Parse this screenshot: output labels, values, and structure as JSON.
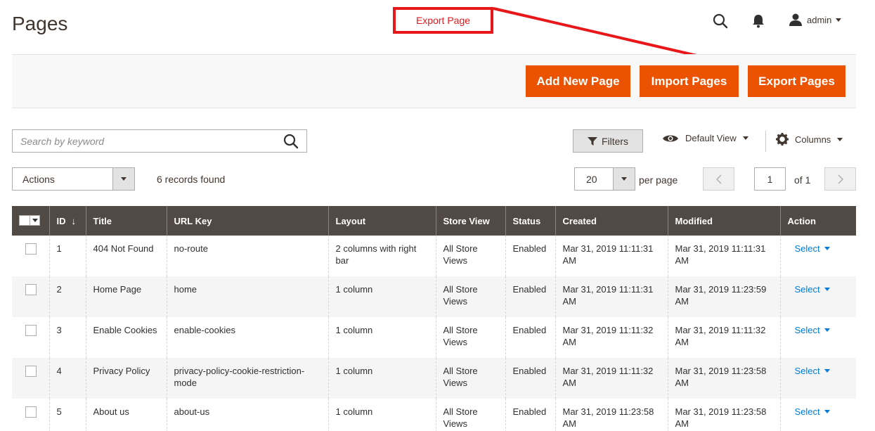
{
  "header": {
    "title": "Pages",
    "annotation_label": "Export Page",
    "user_name": "admin"
  },
  "toolbar": {
    "add_new_label": "Add New Page",
    "import_label": "Import Pages",
    "export_label": "Export Pages"
  },
  "search": {
    "placeholder": "Search by keyword"
  },
  "controls": {
    "filters_label": "Filters",
    "view_label": "Default View",
    "columns_label": "Columns",
    "actions_label": "Actions",
    "records_found": "6 records found",
    "per_page_value": "20",
    "per_page_label": "per page",
    "current_page": "1",
    "page_total": "of 1"
  },
  "grid": {
    "columns": [
      "ID",
      "Title",
      "URL Key",
      "Layout",
      "Store View",
      "Status",
      "Created",
      "Modified",
      "Action"
    ],
    "sort_glyph": "↓",
    "rows": [
      {
        "id": "1",
        "title": "404 Not Found",
        "url_key": "no-route",
        "layout": "2 columns with right bar",
        "store_view": "All Store Views",
        "status": "Enabled",
        "created": "Mar 31, 2019 11:11:31 AM",
        "modified": "Mar 31, 2019 11:11:31 AM",
        "action": "Select"
      },
      {
        "id": "2",
        "title": "Home Page",
        "url_key": "home",
        "layout": "1 column",
        "store_view": "All Store Views",
        "status": "Enabled",
        "created": "Mar 31, 2019 11:11:31 AM",
        "modified": "Mar 31, 2019 11:23:59 AM",
        "action": "Select"
      },
      {
        "id": "3",
        "title": "Enable Cookies",
        "url_key": "enable-cookies",
        "layout": "1 column",
        "store_view": "All Store Views",
        "status": "Enabled",
        "created": "Mar 31, 2019 11:11:32 AM",
        "modified": "Mar 31, 2019 11:11:32 AM",
        "action": "Select"
      },
      {
        "id": "4",
        "title": "Privacy Policy",
        "url_key": "privacy-policy-cookie-restriction-mode",
        "layout": "1 column",
        "store_view": "All Store Views",
        "status": "Enabled",
        "created": "Mar 31, 2019 11:11:32 AM",
        "modified": "Mar 31, 2019 11:23:58 AM",
        "action": "Select"
      },
      {
        "id": "5",
        "title": "About us",
        "url_key": "about-us",
        "layout": "1 column",
        "store_view": "All Store Views",
        "status": "Enabled",
        "created": "Mar 31, 2019 11:23:58 AM",
        "modified": "Mar 31, 2019 11:23:58 AM",
        "action": "Select"
      }
    ]
  },
  "colors": {
    "accent": "#eb5202",
    "annotation": "#e8171a",
    "table_header": "#514943",
    "link": "#007bdb"
  },
  "icons": [
    "search-icon",
    "bell-icon",
    "user-icon",
    "filter-icon",
    "eye-icon",
    "gear-icon",
    "chevron-left-icon",
    "chevron-right-icon"
  ]
}
